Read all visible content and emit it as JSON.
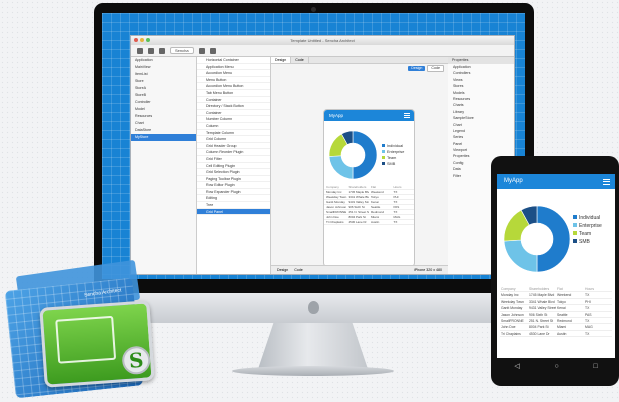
{
  "window": {
    "title": "Template Untitled - Sencha Architect",
    "toolbar_select": "Sencha"
  },
  "project_tree": {
    "items": [
      "Application",
      "MainView",
      "ItemList",
      "Store",
      "StoreA",
      "StoreB",
      "Controller",
      "Model",
      "Resources",
      "Chart",
      "DataStore",
      "MyStore"
    ],
    "selected_index": 11
  },
  "toolbox": {
    "items": [
      "Horizontal Container",
      "Application Menu",
      "Accordion Menu",
      "Menu Button",
      "Accordion Menu Button",
      "Tab Menu Button",
      "Container",
      "Directory / Stack Button",
      "Container",
      "Number Column",
      "Column",
      "Template Column",
      "Grid Column",
      "Grid Header Group",
      "Column Reorder Plugin",
      "Grid Filter",
      "Cell Editing Plugin",
      "Grid Selection Plugin",
      "Paging Toolbar Plugin",
      "Row Editor Plugin",
      "Row Expander Plugin",
      "Editing",
      "Tree",
      "Grid Panel"
    ],
    "selected_index": 23
  },
  "canvas": {
    "tabs": [
      "Design",
      "Code"
    ],
    "buttons": [
      "Design",
      "Code"
    ],
    "footer": [
      "Design",
      "Code"
    ],
    "zoom_label": "iPhone 320 x 480"
  },
  "config": {
    "header": "Properties",
    "items": [
      "Application",
      "Controllers",
      "Views",
      "Stores",
      "Models",
      "Resources",
      "Charts",
      "Library",
      "SampleStore",
      "Chart",
      "Legend",
      "Series",
      "Panel",
      "Viewport",
      "Properties",
      "Config",
      "Data",
      "Filter"
    ]
  },
  "app": {
    "name": "MyApp",
    "legend": [
      "Individual",
      "Enterprise",
      "Team",
      "SMB"
    ],
    "table_headers": [
      "Company",
      "Shareholders",
      "Flat",
      "Hours"
    ],
    "table_rows": [
      [
        "Monday Inc",
        "1745 Maple Blvd",
        "Weekend",
        "TX"
      ],
      [
        "Weekday Town",
        "3341 Whale Blvd",
        "Tokyo",
        "PHI"
      ],
      [
        "Gantt Monday",
        "9431 Valley Street",
        "Kenai",
        "TX"
      ],
      [
        "Jason Johnson",
        "906 Sixth St",
        "Seattle",
        "PAS"
      ],
      [
        "SmallFRONNE",
        "251 N. Street St",
        "Redmond",
        "TX"
      ],
      [
        "John Doe",
        "8004 Park St",
        "Miami",
        "MAG"
      ],
      [
        "Tri Chaplains",
        "4530 Lane Dr",
        "Austin",
        "TX"
      ]
    ]
  },
  "tablet": {
    "title": "MyApp"
  },
  "icon": {
    "caption": "Sencha Architect"
  },
  "chart_data": {
    "type": "pie",
    "categories": [
      "Individual",
      "Enterprise",
      "Team",
      "SMB"
    ],
    "values": [
      50,
      24,
      18,
      8
    ],
    "colors": [
      "#1f7ccc",
      "#6ec3e8",
      "#b6d83a",
      "#1c4f86"
    ]
  }
}
